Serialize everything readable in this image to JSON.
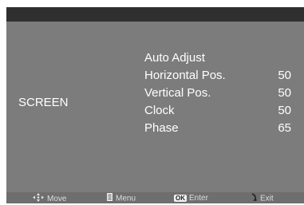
{
  "osd": {
    "category": "SCREEN",
    "items": [
      {
        "label": "Auto Adjust",
        "value": ""
      },
      {
        "label": "Horizontal Pos.",
        "value": "50"
      },
      {
        "label": "Vertical Pos.",
        "value": "50"
      },
      {
        "label": "Clock",
        "value": "50"
      },
      {
        "label": "Phase",
        "value": "65"
      }
    ]
  },
  "hints": {
    "move": {
      "icon": "directional-pad-icon",
      "label": "Move"
    },
    "menu": {
      "icon": "menu-icon",
      "label": "Menu"
    },
    "enter": {
      "icon": "ok-icon",
      "badge": "OK",
      "label": "Enter"
    },
    "exit": {
      "icon": "return-arrow-icon",
      "label": "Exit"
    }
  }
}
